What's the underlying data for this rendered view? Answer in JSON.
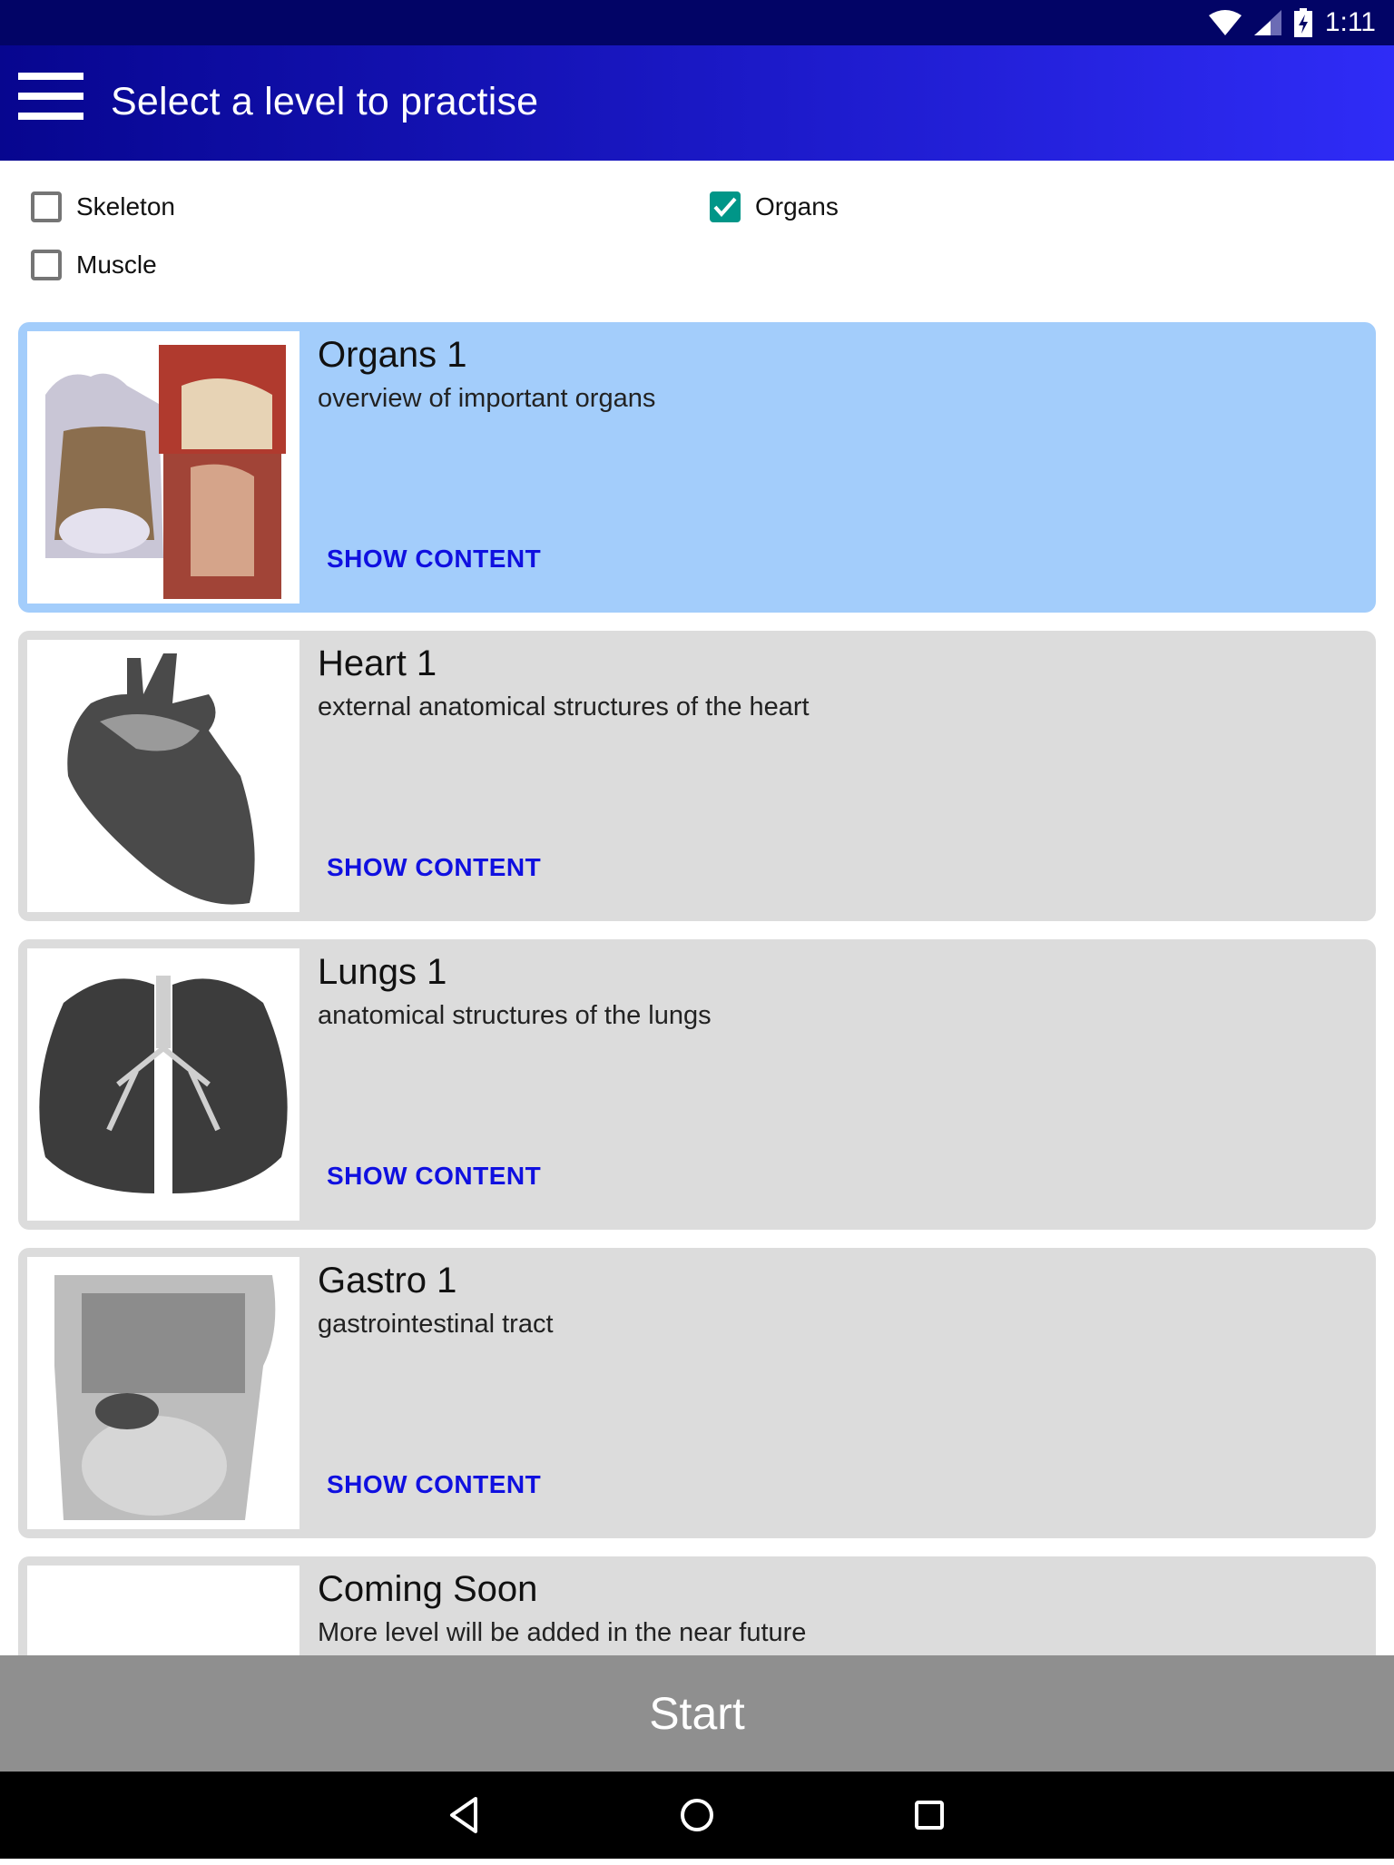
{
  "status_bar": {
    "time": "1:11",
    "icons": [
      "wifi-icon",
      "signal-icon",
      "battery-charging-icon"
    ]
  },
  "app_bar": {
    "menu_icon": "hamburger-menu-icon",
    "title": "Select a level to practise"
  },
  "filters": [
    {
      "label": "Skeleton",
      "checked": false
    },
    {
      "label": "Organs",
      "checked": true
    },
    {
      "label": "Muscle",
      "checked": false
    }
  ],
  "levels": [
    {
      "title": "Organs 1",
      "subtitle": "overview of important organs",
      "action": "SHOW CONTENT",
      "selected": true,
      "image": "organs-illustration"
    },
    {
      "title": "Heart 1",
      "subtitle": "external anatomical structures of the heart",
      "action": "SHOW CONTENT",
      "selected": false,
      "image": "heart-illustration"
    },
    {
      "title": "Lungs 1",
      "subtitle": "anatomical structures of the lungs",
      "action": "SHOW CONTENT",
      "selected": false,
      "image": "lungs-illustration"
    },
    {
      "title": "Gastro 1",
      "subtitle": "gastrointestinal tract",
      "action": "SHOW CONTENT",
      "selected": false,
      "image": "gastro-illustration"
    },
    {
      "title": "Coming Soon",
      "subtitle": "More level will be added in the near future",
      "action": "",
      "selected": false,
      "image": "blank"
    }
  ],
  "start_button": {
    "label": "Start"
  },
  "nav_bar": {
    "icons": [
      "back-icon",
      "home-icon",
      "recents-icon"
    ]
  },
  "colors": {
    "status_bar": "#020466",
    "app_bar_start": "#07068f",
    "app_bar_end": "#2f2cf7",
    "selected_card": "#a3cdfb",
    "card": "#dcdcdc",
    "checkbox_checked": "#009688",
    "action_link": "#1010e0",
    "start_bar": "#8f8f8f"
  }
}
